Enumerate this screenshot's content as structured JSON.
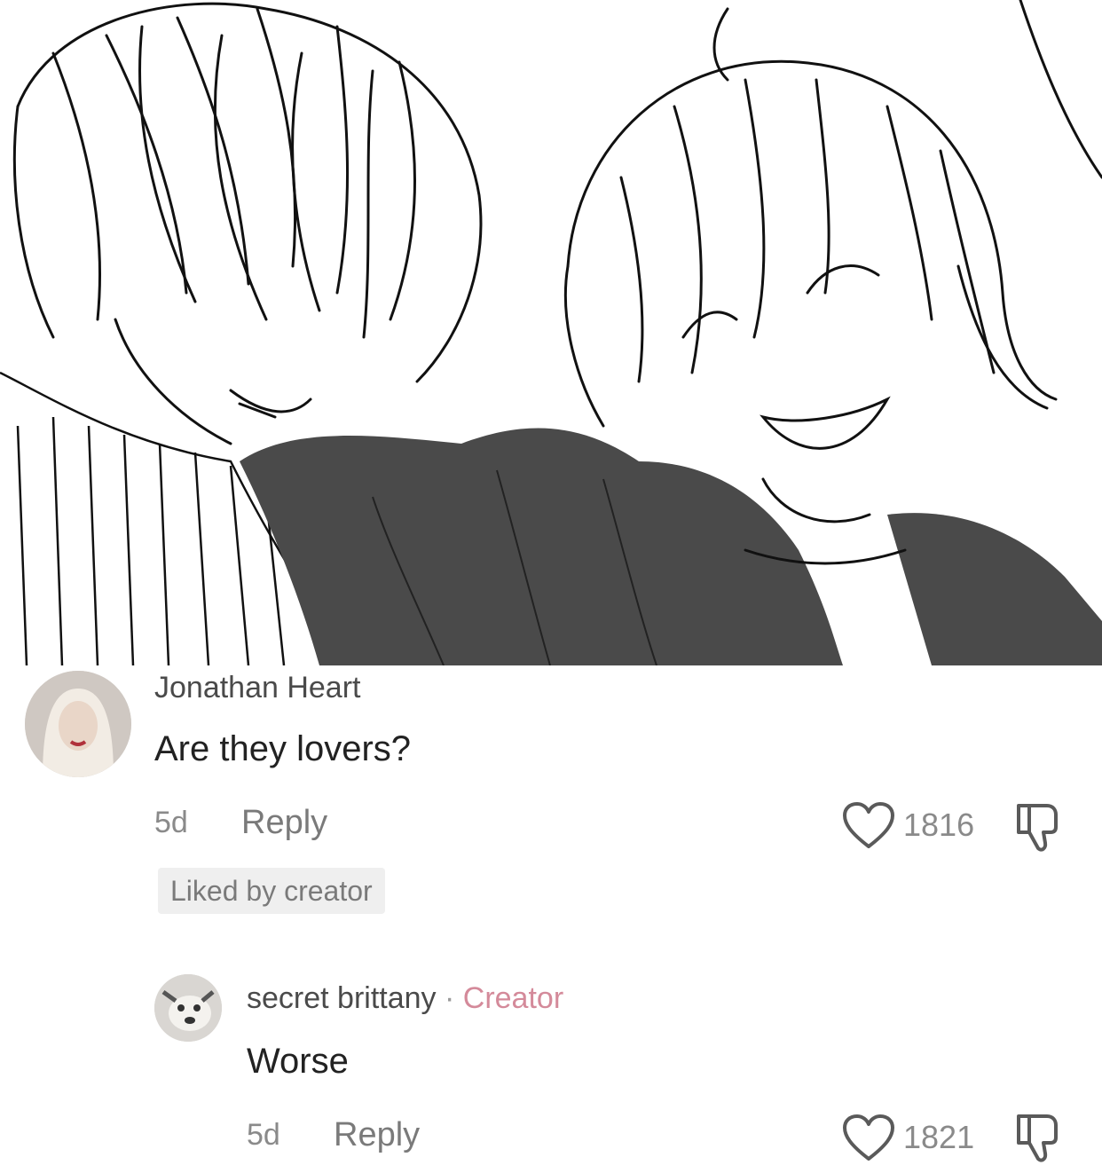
{
  "comments": [
    {
      "username": "Jonathan Heart",
      "text": "Are they lovers?",
      "time": "5d",
      "reply_label": "Reply",
      "likes": "1816",
      "badge": "Liked by creator",
      "avatar_icon": "user-avatar-icon",
      "like_icon": "heart-icon",
      "dislike_icon": "thumbs-down-icon"
    },
    {
      "username": "secret brittany",
      "separator": "·",
      "role": "Creator",
      "text": "Worse",
      "time": "5d",
      "reply_label": "Reply",
      "likes": "1821",
      "avatar_icon": "creator-avatar-icon",
      "like_icon": "heart-icon",
      "dislike_icon": "thumbs-down-icon"
    }
  ],
  "colors": {
    "creator_tag": "#d48a9a",
    "secondary_text": "#8a8a8a",
    "badge_bg": "#efefef"
  }
}
